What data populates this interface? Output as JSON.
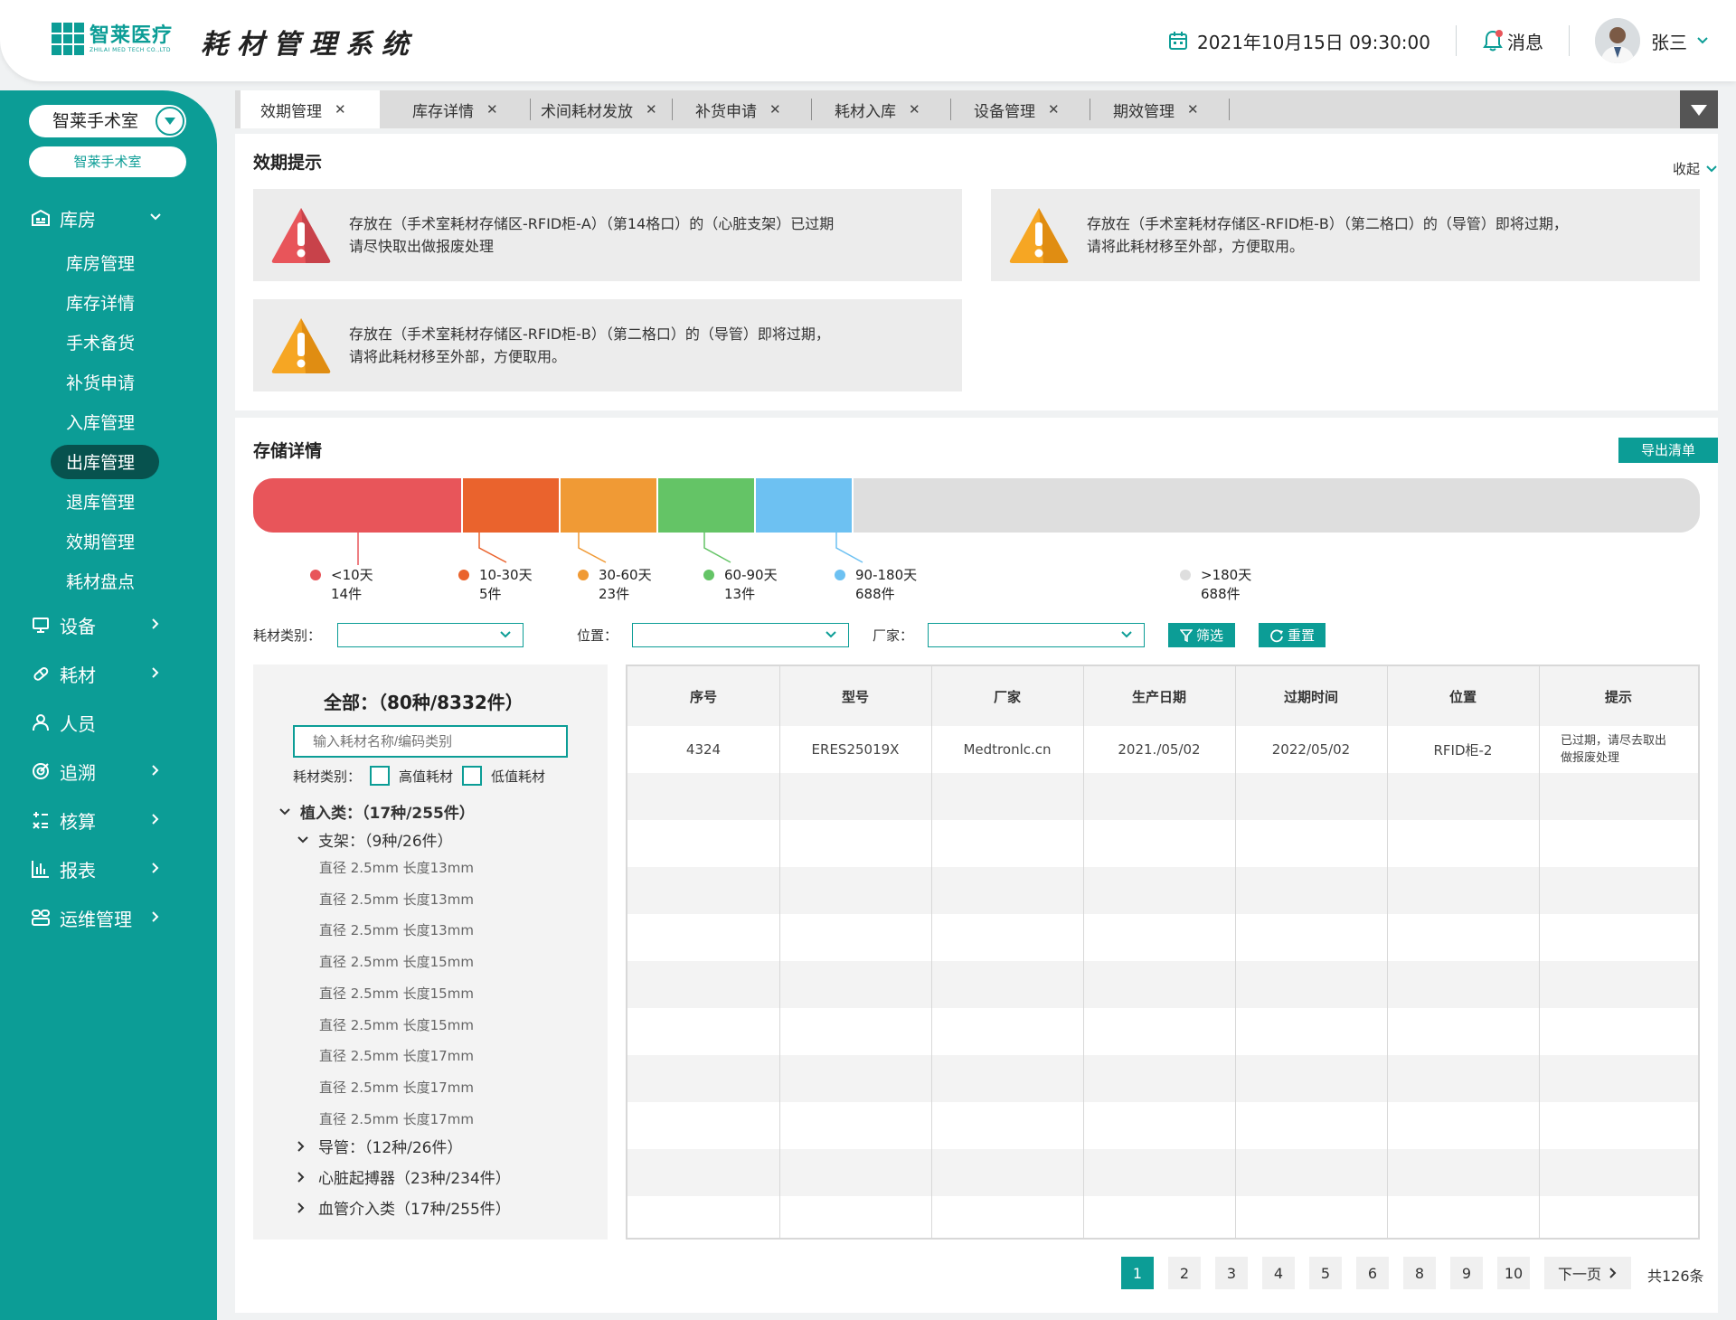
{
  "header": {
    "logo_cn": "智莱医疗",
    "logo_en": "ZHILAI MED TECH CO.,LTD",
    "system_title": "耗材管理系统",
    "datetime": "2021年10月15日 09:30:00",
    "messages_label": "消息",
    "user_name": "张三"
  },
  "sidebar": {
    "room_select": "智莱手术室",
    "room_badge": "智莱手术室",
    "groups": {
      "warehouse": "库房",
      "equipment": "设备",
      "consumables": "耗材",
      "personnel": "人员",
      "trace": "追溯",
      "accounting": "核算",
      "reports": "报表",
      "ops": "运维管理"
    },
    "warehouse_items": [
      "库房管理",
      "库存详情",
      "手术备货",
      "补货申请",
      "入库管理",
      "出库管理",
      "退库管理",
      "效期管理",
      "耗材盘点"
    ],
    "active_item": "出库管理"
  },
  "tabs": [
    "效期管理",
    "库存详情",
    "术间耗材发放",
    "补货申请",
    "耗材入库",
    "设备管理",
    "期效管理"
  ],
  "expiry": {
    "title": "效期提示",
    "collapse_label": "收起",
    "alerts": [
      {
        "line1": "存放在（手术室耗材存储区-RFID柜-A）（第14格口）的（心脏支架）已过期",
        "line2": "请尽快取出做报废处理",
        "level": "expired"
      },
      {
        "line1": "存放在（手术室耗材存储区-RFID柜-B）（第二格口）的（导管）即将过期，",
        "line2": "请将此耗材移至外部，方便取用。",
        "level": "warning"
      },
      {
        "line1": "存放在（手术室耗材存储区-RFID柜-B）（第二格口）的（导管）即将过期，",
        "line2": "请将此耗材移至外部，方便取用。",
        "level": "warning"
      }
    ]
  },
  "storage": {
    "title": "存储详情",
    "export_label": "导出清单",
    "colors": [
      "#e8555a",
      "#ea632d",
      "#f09a35",
      "#64c466",
      "#6dc1f2",
      "#dedede"
    ],
    "legend": [
      {
        "label": "<10天",
        "count": "14件"
      },
      {
        "label": "10-30天",
        "count": "5件"
      },
      {
        "label": "30-60天",
        "count": "23件"
      },
      {
        "label": "60-90天",
        "count": "13件"
      },
      {
        "label": "90-180天",
        "count": "688件"
      },
      {
        "label": ">180天",
        "count": "688件"
      }
    ]
  },
  "filters": {
    "category_label": "耗材类别：",
    "location_label": "位置：",
    "vendor_label": "厂家：",
    "filter_btn": "筛选",
    "reset_btn": "重置"
  },
  "tree": {
    "total": "全部：（80种/8332件）",
    "search_placeholder": "输入耗材名称/编码类别",
    "type_label": "耗材类别：",
    "high_value": "高值耗材",
    "low_value": "低值耗材",
    "implant": "植入类：（17种/255件）",
    "stent": "支架：（9种/26件）",
    "leaves": [
      "直径 2.5mm  长度13mm",
      "直径 2.5mm  长度13mm",
      "直径 2.5mm  长度13mm",
      "直径 2.5mm  长度15mm",
      "直径 2.5mm  长度15mm",
      "直径 2.5mm  长度15mm",
      "直径 2.5mm  长度17mm",
      "直径 2.5mm  长度17mm",
      "直径 2.5mm  长度17mm"
    ],
    "catheter": "导管：（12种/26件）",
    "pacemaker": "心脏起搏器（23种/234件）",
    "vascular": "血管介入类（17种/255件）"
  },
  "table": {
    "headers": [
      "序号",
      "型号",
      "厂家",
      "生产日期",
      "过期时间",
      "位置",
      "提示"
    ],
    "rows": [
      {
        "no": "4324",
        "model": "ERES25019X",
        "vendor": "Medtronlc.cn",
        "mfg": "2021./05/02",
        "exp": "2022/05/02",
        "loc": "RFID柜-2",
        "tip1": "已过期，请尽去取出",
        "tip2": "做报废处理"
      }
    ]
  },
  "pagination": {
    "pages": [
      "1",
      "2",
      "3",
      "4",
      "5",
      "6",
      "8",
      "9",
      "10"
    ],
    "next_label": "下一页",
    "total": "共126条",
    "current": "1"
  }
}
